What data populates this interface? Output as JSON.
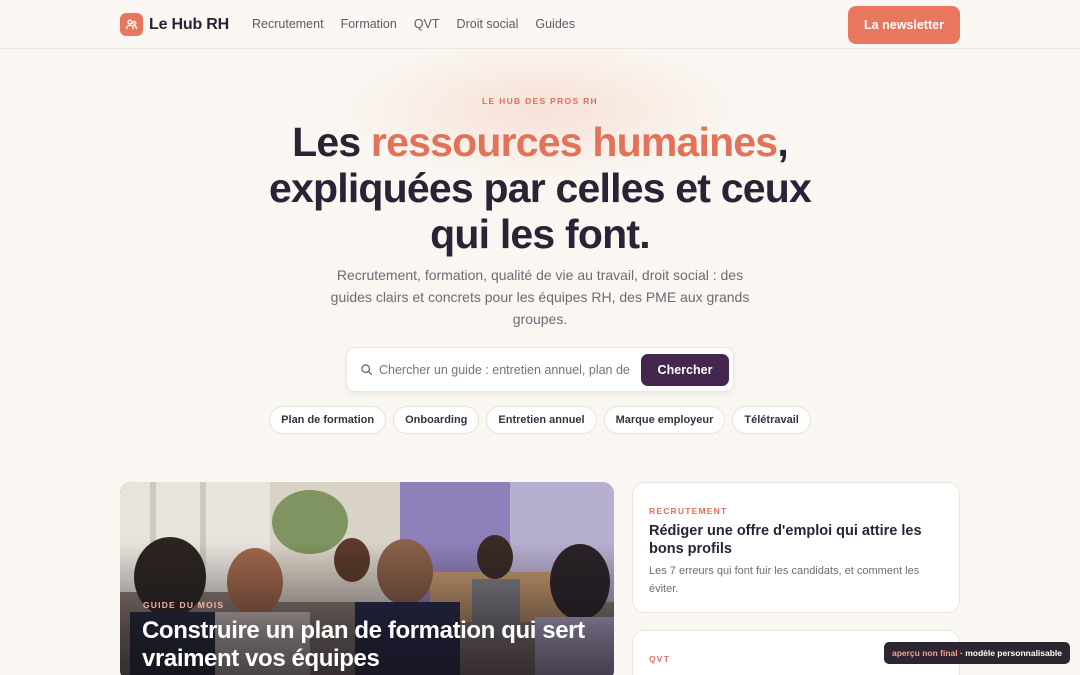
{
  "brand": {
    "name": "Le Hub RH",
    "accent": "#e9765f",
    "dark": "#44264f",
    "background": "#faf6f1"
  },
  "nav": {
    "links": [
      "Recrutement",
      "Formation",
      "QVT",
      "Droit social",
      "Guides"
    ],
    "cta": "La newsletter"
  },
  "hero": {
    "eyebrow": "LE HUB DES PROS RH",
    "title_pre": "Les ",
    "title_highlight": "ressources humaines",
    "title_post": ", expliquées par celles et ceux qui les font.",
    "subtitle": "Recrutement, formation, qualité de vie au travail, droit social : des guides clairs et concrets pour les équipes RH, des PME aux grands groupes."
  },
  "search": {
    "placeholder": "Chercher un guide : entretien annuel, plan de formation…",
    "button": "Chercher"
  },
  "chips": [
    "Plan de formation",
    "Onboarding",
    "Entretien annuel",
    "Marque employeur",
    "Télétravail"
  ],
  "feature": {
    "tag": "GUIDE DU MOIS",
    "title": "Construire un plan de formation qui sert vraiment vos équipes"
  },
  "cards": [
    {
      "tag": "RECRUTEMENT",
      "title": "Rédiger une offre d'emploi qui attire les bons profils",
      "desc": "Les 7 erreurs qui font fuir les candidats, et comment les éviter."
    },
    {
      "tag": "QVT",
      "title": ""
    }
  ],
  "badge": {
    "part1": "aperçu non final",
    "sep": " · ",
    "part2": "modèle personnalisable"
  }
}
